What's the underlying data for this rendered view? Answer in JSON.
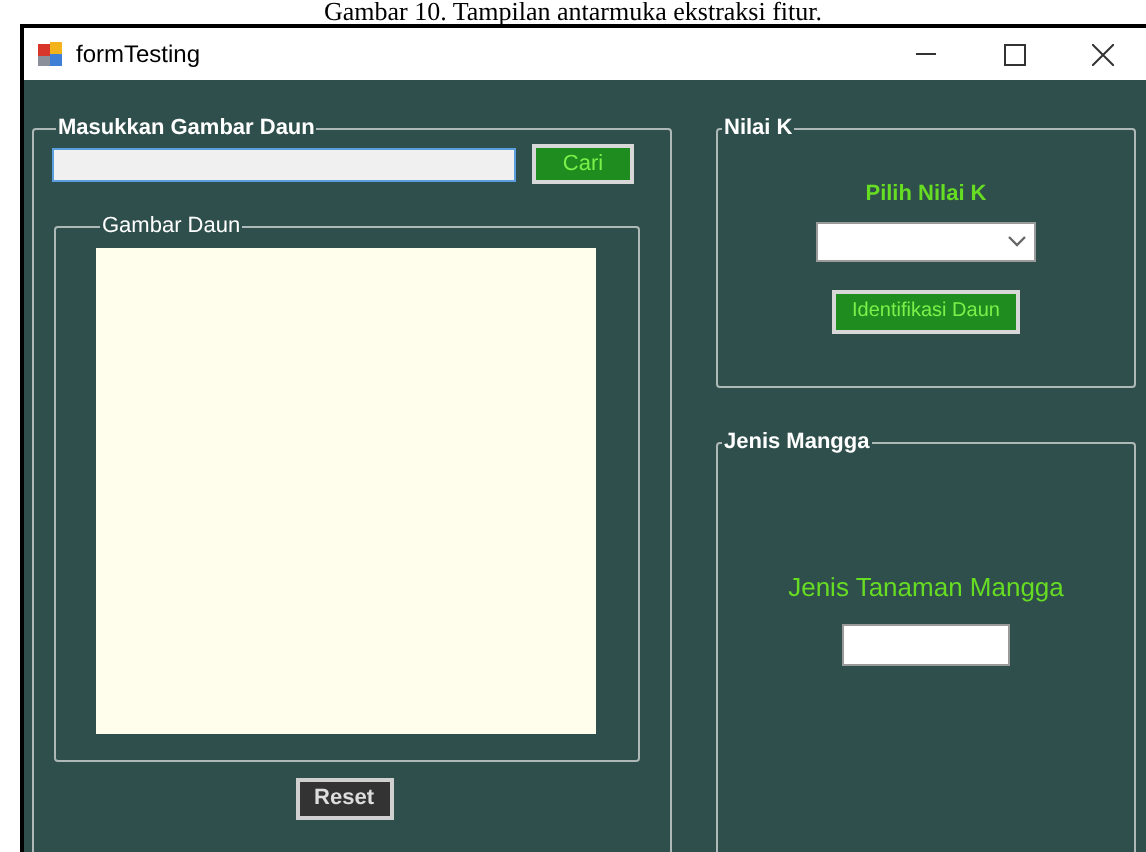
{
  "caption": "Gambar 10. Tampilan antarmuka ekstraksi fitur.",
  "window": {
    "title": "formTesting"
  },
  "input_group": {
    "title": "Masukkan Gambar Daun",
    "button": "Cari"
  },
  "image_group": {
    "title": "Gambar Daun"
  },
  "reset_button": "Reset",
  "k_group": {
    "title": "Nilai K",
    "label": "Pilih Nilai K",
    "button": "Identifikasi Daun"
  },
  "result_group": {
    "title": "Jenis Mangga",
    "label": "Jenis Tanaman Mangga"
  }
}
